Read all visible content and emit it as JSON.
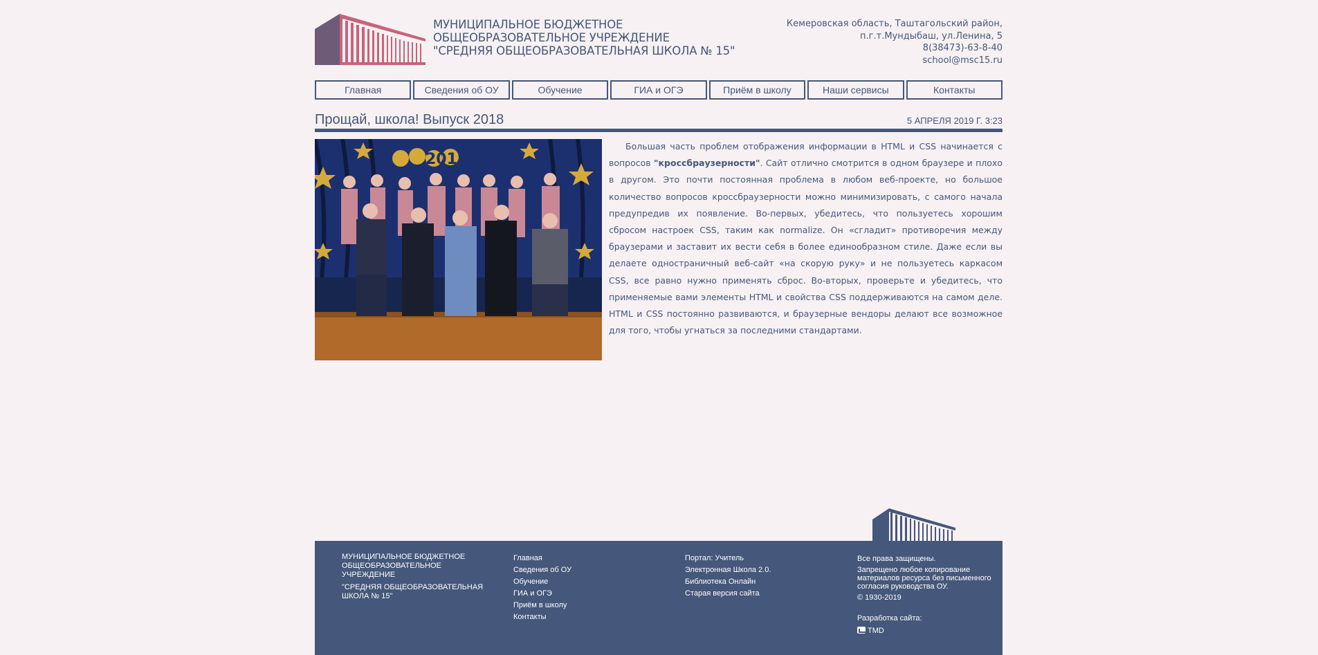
{
  "header": {
    "name_lines": [
      "МУНИЦИПАЛЬНОЕ БЮДЖЕТНОЕ",
      "ОБЩЕОБРАЗОВАТЕЛЬНОЕ УЧРЕЖДЕНИЕ",
      "\"СРЕДНЯЯ ОБЩЕОБРАЗОВАТЕЛЬНАЯ ШКОЛА № 15\""
    ],
    "contact_lines": [
      "Кемеровская область, Таштагольский район,",
      "п.г.т.Мундыбаш, ул.Ленина, 5",
      "8(38473)-63-8-40",
      "school@msc15.ru"
    ]
  },
  "nav": [
    "Главная",
    "Сведения об ОУ",
    "Обучение",
    "ГИА и ОГЭ",
    "Приём в школу",
    "Наши сервисы",
    "Контакты"
  ],
  "article": {
    "title": "Прощай, школа! Выпуск 2018",
    "date": "5 апреля 2019 г. 3:23",
    "text_before": "Большая часть проблем отображения информации в HTML и CSS начинается с вопросов ",
    "text_bold": "\"кроссбраузерности\"",
    "text_after": ". Сайт отлично смотрится в одном браузере и плохо в другом. Это почти постоянная проблема в любом веб-проекте, но большое количество вопросов кроссбраузерности можно минимизировать, с самого начала предупредив их появление. Во-первых, убедитесь, что пользуетесь хорошим сбросом настроек CSS, таким как normalize. Он «сгладит» противоречия между браузерами и заставит их вести себя в более единообразном стиле. Даже если вы делаете одностраничный веб-сайт «на скорую руку» и не пользуетесь каркасом CSS, все равно нужно применять сброс. Во-вторых, проверьте и убедитесь, что применяемые вами элементы HTML и свойства CSS поддерживаются на самом деле. HTML и CSS постоянно развиваются, и браузерные вендоры делают все возможное для того, чтобы угнаться за последними стандартами.",
    "photo_text": "2018"
  },
  "footer": {
    "name_lines": [
      "МУНИЦИПАЛЬНОЕ БЮДЖЕТНОЕ",
      "ОБЩЕОБРАЗОВАТЕЛЬНОЕ УЧРЕЖДЕНИЕ",
      "\"СРЕДНЯЯ ОБЩЕОБРАЗОВАТЕЛЬНАЯ",
      "ШКОЛА № 15\""
    ],
    "menu": [
      "Главная",
      "Сведения об ОУ",
      "Обучение",
      "ГИА и ОГЭ",
      "Приём в школу",
      "Контакты"
    ],
    "services": [
      "Портал: Учитель",
      "Электронная Школа 2.0.",
      "Библиотека Онлайн",
      "Старая версия сайта"
    ],
    "rights": "Все права защищены.",
    "copy_lines": [
      "Запрещено любое копирование",
      "материалов ресурса без письменного",
      "согласия руководства ОУ."
    ],
    "years": "© 1930-2019",
    "dev_label": "Разработка сайта:",
    "dev_name": "TMD"
  },
  "colors": {
    "background": "#f7f1f3",
    "primary": "#45577a",
    "logo_pink": "#c8637a",
    "logo_purple": "#6e5b78"
  }
}
